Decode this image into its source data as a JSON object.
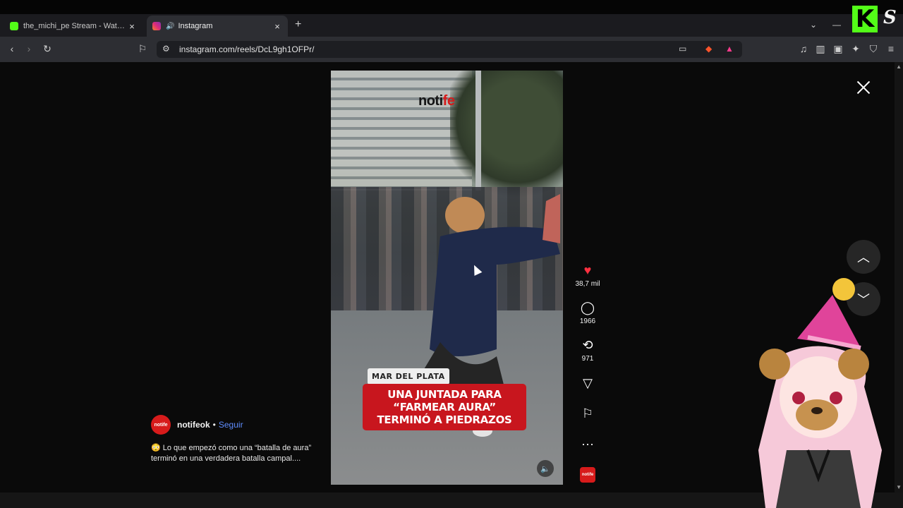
{
  "browser": {
    "tabs": [
      {
        "title": "the_michi_pe Stream - Watch Live on",
        "active": false,
        "favicon_color": "#53fc18"
      },
      {
        "title": "Instagram",
        "active": true,
        "favicon_color": "#d62976"
      }
    ],
    "url": "instagram.com/reels/DcL9gh1OFPr/"
  },
  "reel": {
    "watermark": {
      "part1": "noti",
      "part2": "fe"
    },
    "location_tag": "MAR DEL PLATA",
    "headline": "UNA JUNTADA PARA “FARMEAR AURA” TERMINÓ A PIEDRAZOS",
    "likes": "38,7 mil",
    "comments": "1966",
    "reposts": "971",
    "profile_badge": "notife",
    "author": {
      "avatar_text": "notife",
      "name": "notifeok",
      "separator": "•",
      "follow_label": "Seguir"
    },
    "caption": "😳 Lo que empezó como una “batalla de aura” terminó en una verdadera batalla campal...."
  },
  "overlay": {
    "brand_k": "K",
    "brand_s": "S"
  },
  "colors": {
    "accent_like": "#ff3040",
    "follow_link": "#5f8dff",
    "headline_bg": "#c8161e",
    "kick_green": "#53fc18"
  }
}
